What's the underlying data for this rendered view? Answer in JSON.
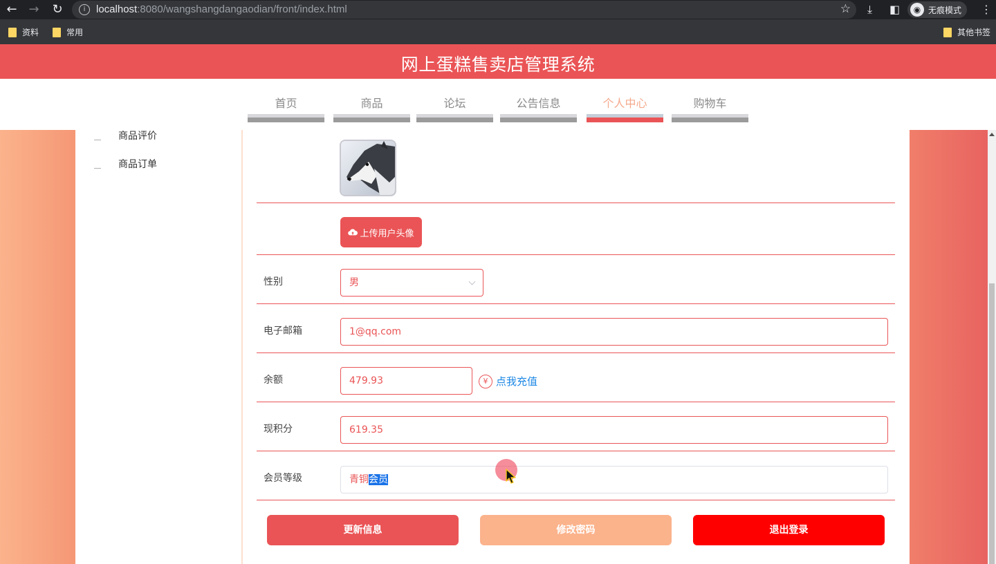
{
  "browser": {
    "url_host": "localhost",
    "url_rest": ":8080/wangshangdangaodian/front/index.html",
    "incognito_label": "无痕模式",
    "bookmarks": [
      "资料",
      "常用"
    ],
    "other_bookmarks": "其他书签"
  },
  "header": {
    "title": "网上蛋糕售卖店管理系统"
  },
  "nav": {
    "items": [
      {
        "label": "首页"
      },
      {
        "label": "商品"
      },
      {
        "label": "论坛"
      },
      {
        "label": "公告信息"
      },
      {
        "label": "个人中心"
      },
      {
        "label": "购物车"
      }
    ],
    "active": "个人中心"
  },
  "side_menu": {
    "items": [
      {
        "label": "商品评价"
      },
      {
        "label": "商品订单"
      }
    ]
  },
  "profile": {
    "upload_avatar_label": "上传用户头像",
    "gender_label": "性别",
    "gender_value": "男",
    "email_label": "电子邮箱",
    "email_value": "1@qq.com",
    "balance_label": "余额",
    "balance_value": "479.93",
    "recharge_icon_text": "¥",
    "recharge_label": "点我充值",
    "points_label": "现积分",
    "points_value": "619.35",
    "level_label": "会员等级",
    "level_value_prefix": "青铜",
    "level_value_selected": "会员"
  },
  "actions": {
    "update_label": "更新信息",
    "password_label": "修改密码",
    "logout_label": "退出登录"
  },
  "colors": {
    "primary": "#ea5456",
    "secondary": "#fbb38c",
    "danger": "#ff0000",
    "link": "#1e88e5"
  }
}
